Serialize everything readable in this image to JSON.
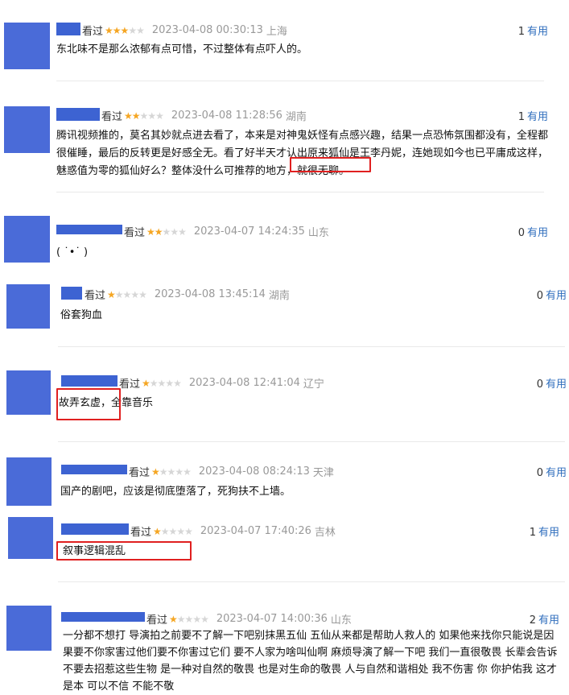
{
  "labels": {
    "seen": "看过",
    "useful": "有用"
  },
  "colors": {
    "avatar": "#4a6bd8",
    "star_on": "#f5a623",
    "star_off": "#d6d6d6",
    "useful_link": "#2f6ebd",
    "highlight": "#e02020"
  },
  "reviews": [
    {
      "rating": 3,
      "time": "2023-04-08 00:30:13",
      "location": "上海",
      "useful_count": "1",
      "content": "东北味不是那么浓郁有点可惜，不过整体有点吓人的。"
    },
    {
      "rating": 2,
      "time": "2023-04-08 11:28:56",
      "location": "湖南",
      "useful_count": "1",
      "content": "腾讯视频推的，莫名其妙就点进去看了，本来是对神鬼妖怪有点感兴趣，结果一点恐怖氛围都没有，全程都很催睡，最后的反转更是好感全无。看了好半天才认出原来狐仙是王李丹妮，连她现如今也已平庸成这样，魅惑值为零的狐仙好么？整体没什么可推荐的地方，就很无聊。"
    },
    {
      "rating": 2,
      "time": "2023-04-07 14:24:35",
      "location": "山东",
      "useful_count": "0",
      "content": "( ˙•˙ )"
    },
    {
      "rating": 1,
      "time": "2023-04-08 13:45:14",
      "location": "湖南",
      "useful_count": "0",
      "content": "俗套狗血"
    },
    {
      "rating": 1,
      "time": "2023-04-08 12:41:04",
      "location": "辽宁",
      "useful_count": "0",
      "content": "故弄玄虚，全靠音乐"
    },
    {
      "rating": 1,
      "time": "2023-04-08 08:24:13",
      "location": "天津",
      "useful_count": "0",
      "content": "国产的剧吧，应该是彻底堕落了，死狗扶不上墙。"
    },
    {
      "rating": 1,
      "time": "2023-04-07 17:40:26",
      "location": "吉林",
      "useful_count": "1",
      "content": "叙事逻辑混乱"
    },
    {
      "rating": 1,
      "time": "2023-04-07 14:00:36",
      "location": "山东",
      "useful_count": "2",
      "content": "一分都不想打 导演拍之前要不了解一下吧别抹黑五仙 五仙从来都是帮助人救人的 如果他来找你只能说是因果要不你家害过他们要不你害过它们 要不人家为啥叫仙啊 麻烦导演了解一下吧 我们一直很敬畏 长辈会告诉不要去招惹这些生物 是一种对自然的敬畏 也是对生命的敬畏 人与自然和谐相处 我不伤害 你 你护佑我 这才是本 可以不信 不能不敬"
    }
  ]
}
